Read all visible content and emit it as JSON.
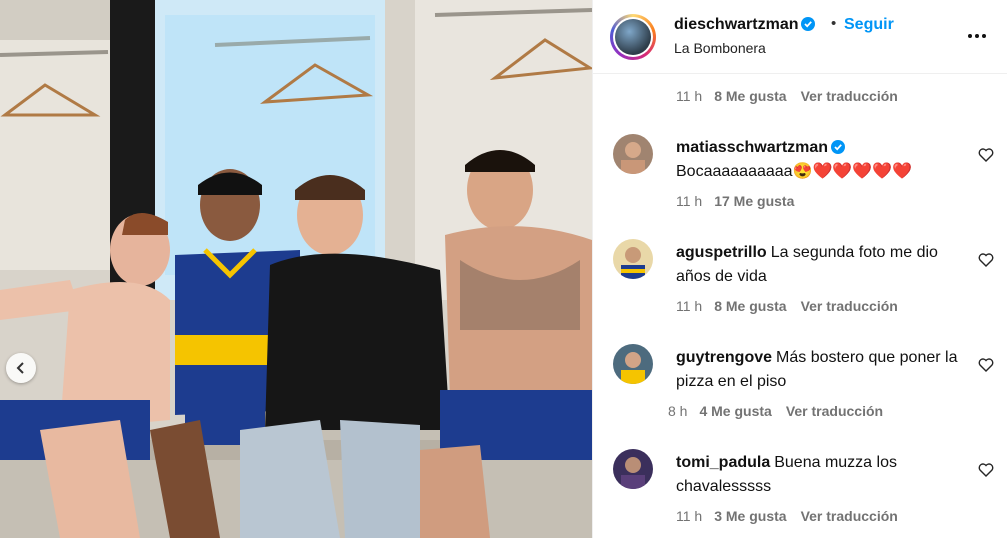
{
  "header": {
    "username": "dieschwartzman",
    "separator": "•",
    "follow_label": "Seguir",
    "location": "La Bombonera",
    "verified_icon": "verified-badge-icon",
    "more_icon": "more-options-icon"
  },
  "caption_meta": {
    "time": "11 h",
    "likes": "8 Me gusta",
    "translate": "Ver traducción"
  },
  "comments": [
    {
      "username": "matiasschwartzman",
      "verified": true,
      "text": "Bocaaaaaaaaaa😍❤️❤️❤️❤️❤️",
      "time": "11 h",
      "likes": "17 Me gusta",
      "translate": ""
    },
    {
      "username": "aguspetrillo",
      "verified": false,
      "text": "La segunda foto me dio años de vida",
      "time": "11 h",
      "likes": "8 Me gusta",
      "translate": "Ver traducción"
    },
    {
      "username": "guytrengove",
      "verified": false,
      "text": "Más bostero que poner la pizza en el piso",
      "time": "8 h",
      "likes": "4 Me gusta",
      "translate": "Ver traducción"
    },
    {
      "username": "tomi_padula",
      "verified": false,
      "text": "Buena muzza los chavalesssss",
      "time": "11 h",
      "likes": "3 Me gusta",
      "translate": "Ver traducción"
    }
  ],
  "colors": {
    "link_blue": "#0095f6",
    "verified_blue": "#0095f6",
    "muted_text": "#737373",
    "boca_blue": "#1d3c8f",
    "boca_yellow": "#f5c400"
  },
  "photo": {
    "prev_icon": "chevron-left-icon"
  }
}
